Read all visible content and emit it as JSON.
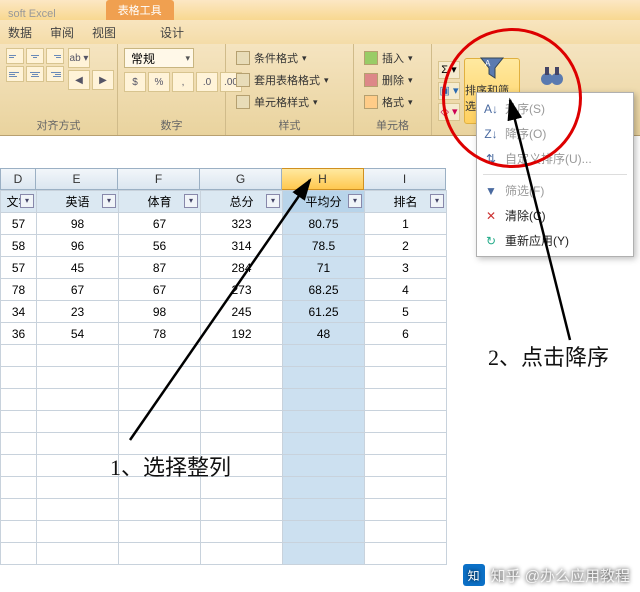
{
  "title": {
    "app": "soft Excel",
    "tooltab": "表格工具"
  },
  "tabs": {
    "data": "数据",
    "review": "审阅",
    "view": "视图",
    "design": "设计"
  },
  "ribbon": {
    "align_label": "对齐方式",
    "number_label": "数字",
    "number_format": "常规",
    "styles_label": "样式",
    "styles": {
      "cond": "条件格式",
      "tbl": "套用表格格式",
      "cell": "单元格样式"
    },
    "cells_label": "单元格",
    "cells": {
      "ins": "插入",
      "del": "删除",
      "fmt": "格式"
    },
    "sort_filter": "排序和筛选",
    "find_select": "查找和选择"
  },
  "menu": {
    "asc": "升序(S)",
    "desc": "降序(O)",
    "custom": "自定义排序(U)...",
    "filter": "筛选(F)",
    "clear": "清除(C)",
    "reapply": "重新应用(Y)"
  },
  "columns": {
    "D": "D",
    "E": "E",
    "F": "F",
    "G": "G",
    "H": "H",
    "I": "I"
  },
  "headers": {
    "D": "文学",
    "E": "英语",
    "F": "体育",
    "G": "总分",
    "H": "平均分",
    "I": "排名"
  },
  "rows": [
    {
      "D": "57",
      "E": "98",
      "F": "67",
      "G": "323",
      "H": "80.75",
      "I": "1"
    },
    {
      "D": "58",
      "E": "96",
      "F": "56",
      "G": "314",
      "H": "78.5",
      "I": "2"
    },
    {
      "D": "57",
      "E": "45",
      "F": "87",
      "G": "284",
      "H": "71",
      "I": "3"
    },
    {
      "D": "78",
      "E": "67",
      "F": "67",
      "G": "273",
      "H": "68.25",
      "I": "4"
    },
    {
      "D": "34",
      "E": "23",
      "F": "98",
      "G": "245",
      "H": "61.25",
      "I": "5"
    },
    {
      "D": "36",
      "E": "54",
      "F": "78",
      "G": "192",
      "H": "48",
      "I": "6"
    }
  ],
  "annotations": {
    "a1": "1、选择整列",
    "a2": "2、点击降序"
  },
  "watermark": "知乎 @办么应用教程"
}
